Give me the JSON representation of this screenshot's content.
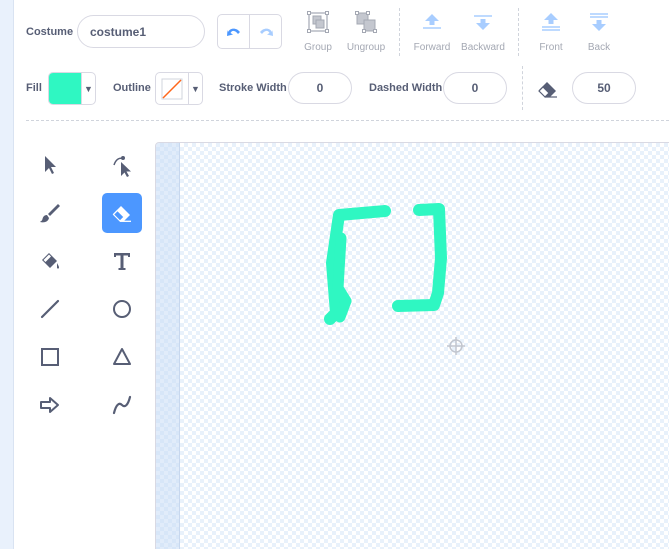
{
  "costume": {
    "label": "Costume",
    "name_value": "costume1"
  },
  "toolbar": {
    "group": "Group",
    "ungroup": "Ungroup",
    "forward": "Forward",
    "backward": "Backward",
    "front": "Front",
    "back": "Back"
  },
  "props": {
    "fill_label": "Fill",
    "fill_color": "#2ff7c2",
    "outline_label": "Outline",
    "dropdown_arrow": "▼",
    "stroke_width_label": "Stroke Width",
    "stroke_width_value": "0",
    "dashed_width_label": "Dashed Width",
    "dashed_width_value": "0",
    "eraser_size_value": "50"
  },
  "tools": [
    {
      "name": "select-tool",
      "icon": "arrow-icon"
    },
    {
      "name": "reshape-tool",
      "icon": "reshape-icon"
    },
    {
      "name": "brush-tool",
      "icon": "brush-icon"
    },
    {
      "name": "eraser-tool",
      "icon": "eraser-icon",
      "active": true
    },
    {
      "name": "fill-tool",
      "icon": "paint-bucket-icon"
    },
    {
      "name": "text-tool",
      "icon": "text-icon"
    },
    {
      "name": "line-tool",
      "icon": "line-icon"
    },
    {
      "name": "circle-tool",
      "icon": "circle-icon"
    },
    {
      "name": "rectangle-tool",
      "icon": "square-icon"
    },
    {
      "name": "triangle-tool",
      "icon": "triangle-icon"
    },
    {
      "name": "arrow-shape-tool",
      "icon": "arrow-shape-icon"
    },
    {
      "name": "curve-tool",
      "icon": "curve-icon"
    }
  ],
  "colors": {
    "accent": "#4c97ff",
    "text": "#575e75",
    "disabled": "#a4a8b3",
    "drawing_stroke": "#2ff7c2"
  }
}
